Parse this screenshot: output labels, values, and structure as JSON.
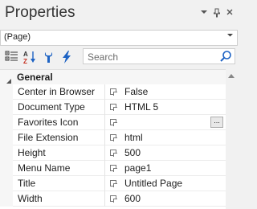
{
  "panel": {
    "title": "Properties",
    "pin_glyph": "📌",
    "close_glyph": "✕",
    "dropdown_glyph": "▾"
  },
  "object_selector": {
    "value": "(Page)"
  },
  "toolbar": {
    "icons": [
      "categorized-icon",
      "alphabetical-icon",
      "properties-wrench-icon",
      "events-lightning-icon"
    ]
  },
  "search": {
    "placeholder": "Search"
  },
  "grid": {
    "category": "General",
    "rows": [
      {
        "name": "Center in Browser",
        "value": "False"
      },
      {
        "name": "Document Type",
        "value": "HTML 5"
      },
      {
        "name": "Favorites Icon",
        "value": "",
        "ellipsis": "..."
      },
      {
        "name": "File Extension",
        "value": "html"
      },
      {
        "name": "Height",
        "value": "500"
      },
      {
        "name": "Menu Name",
        "value": "page1"
      },
      {
        "name": "Title",
        "value": "Untitled Page"
      },
      {
        "name": "Width",
        "value": "600"
      }
    ]
  },
  "colors": {
    "accent_blue": "#1e63c4",
    "background": "#f1f1f1",
    "grid_bg": "#ffffff"
  }
}
